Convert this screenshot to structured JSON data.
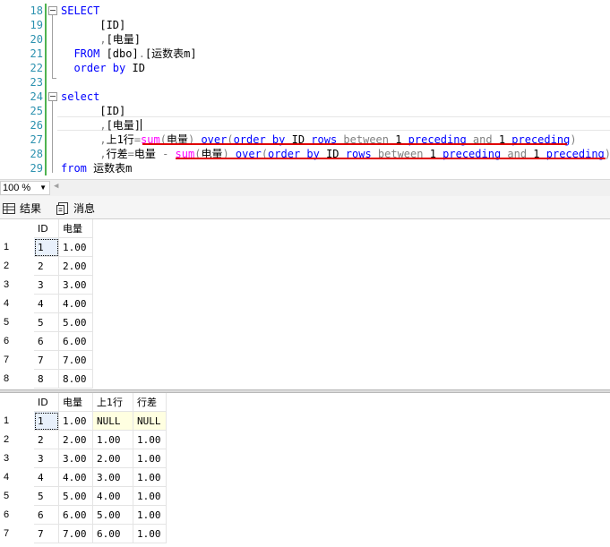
{
  "editor": {
    "line_numbers": [
      "18",
      "19",
      "20",
      "21",
      "22",
      "23",
      "24",
      "25",
      "26",
      "27",
      "28",
      "29"
    ],
    "lines": [
      [
        {
          "t": "SELECT",
          "c": "kw"
        }
      ],
      [
        {
          "t": "      [ID]",
          "c": "tx"
        }
      ],
      [
        {
          "t": "      ,",
          "c": "gr"
        },
        {
          "t": "[电量]",
          "c": "tx"
        }
      ],
      [
        {
          "t": "  FROM ",
          "c": "kw"
        },
        {
          "t": "[dbo]",
          "c": "tx"
        },
        {
          "t": ".",
          "c": "gr"
        },
        {
          "t": "[运数表m]",
          "c": "tx"
        }
      ],
      [
        {
          "t": "  order by ",
          "c": "kw"
        },
        {
          "t": "ID",
          "c": "tx"
        }
      ],
      [],
      [
        {
          "t": "select",
          "c": "kw"
        }
      ],
      [
        {
          "t": "      [ID]",
          "c": "tx"
        }
      ],
      [
        {
          "t": "      ,",
          "c": "gr"
        },
        {
          "t": "[电量]",
          "c": "tx"
        }
      ],
      [
        {
          "t": "      ,",
          "c": "gr"
        },
        {
          "t": "上1行",
          "c": "tx"
        },
        {
          "t": "=",
          "c": "gr"
        },
        {
          "t": "sum",
          "c": "fn"
        },
        {
          "t": "(",
          "c": "gr"
        },
        {
          "t": "电量",
          "c": "tx"
        },
        {
          "t": ") ",
          "c": "gr"
        },
        {
          "t": "over",
          "c": "kw"
        },
        {
          "t": "(",
          "c": "gr"
        },
        {
          "t": "order by ",
          "c": "kw"
        },
        {
          "t": "ID ",
          "c": "tx"
        },
        {
          "t": "rows ",
          "c": "kw"
        },
        {
          "t": "between ",
          "c": "gr"
        },
        {
          "t": "1 ",
          "c": "tx"
        },
        {
          "t": "preceding ",
          "c": "kw"
        },
        {
          "t": "and ",
          "c": "gr"
        },
        {
          "t": "1 ",
          "c": "tx"
        },
        {
          "t": "preceding",
          "c": "kw"
        },
        {
          "t": ")",
          "c": "gr"
        }
      ],
      [
        {
          "t": "      ,",
          "c": "gr"
        },
        {
          "t": "行差",
          "c": "tx"
        },
        {
          "t": "=",
          "c": "gr"
        },
        {
          "t": "电量 ",
          "c": "tx"
        },
        {
          "t": "- ",
          "c": "gr"
        },
        {
          "t": "sum",
          "c": "fn"
        },
        {
          "t": "(",
          "c": "gr"
        },
        {
          "t": "电量",
          "c": "tx"
        },
        {
          "t": ") ",
          "c": "gr"
        },
        {
          "t": "over",
          "c": "kw"
        },
        {
          "t": "(",
          "c": "gr"
        },
        {
          "t": "order by ",
          "c": "kw"
        },
        {
          "t": "ID ",
          "c": "tx"
        },
        {
          "t": "rows ",
          "c": "kw"
        },
        {
          "t": "between ",
          "c": "gr"
        },
        {
          "t": "1 ",
          "c": "tx"
        },
        {
          "t": "preceding ",
          "c": "kw"
        },
        {
          "t": "and ",
          "c": "gr"
        },
        {
          "t": "1 ",
          "c": "tx"
        },
        {
          "t": "preceding",
          "c": "kw"
        },
        {
          "t": ")",
          "c": "gr"
        }
      ],
      [
        {
          "t": "from ",
          "c": "kw"
        },
        {
          "t": "运数表m",
          "c": "tx"
        }
      ]
    ]
  },
  "zoom": {
    "value": "100 %"
  },
  "tabs": [
    {
      "label": "结果",
      "icon": "grid-icon"
    },
    {
      "label": "消息",
      "icon": "message-icon"
    }
  ],
  "grid1": {
    "columns": [
      "ID",
      "电量"
    ],
    "rows": [
      [
        "1",
        "1",
        "1.00"
      ],
      [
        "2",
        "2",
        "2.00"
      ],
      [
        "3",
        "3",
        "3.00"
      ],
      [
        "4",
        "4",
        "4.00"
      ],
      [
        "5",
        "5",
        "5.00"
      ],
      [
        "6",
        "6",
        "6.00"
      ],
      [
        "7",
        "7",
        "7.00"
      ],
      [
        "8",
        "8",
        "8.00"
      ]
    ]
  },
  "grid2": {
    "columns": [
      "ID",
      "电量",
      "上1行",
      "行差"
    ],
    "rows": [
      [
        "1",
        "1",
        "1.00",
        "NULL",
        "NULL"
      ],
      [
        "2",
        "2",
        "2.00",
        "1.00",
        "1.00"
      ],
      [
        "3",
        "3",
        "3.00",
        "2.00",
        "1.00"
      ],
      [
        "4",
        "4",
        "4.00",
        "3.00",
        "1.00"
      ],
      [
        "5",
        "5",
        "5.00",
        "4.00",
        "1.00"
      ],
      [
        "6",
        "6",
        "6.00",
        "5.00",
        "1.00"
      ],
      [
        "7",
        "7",
        "7.00",
        "6.00",
        "1.00"
      ]
    ]
  }
}
